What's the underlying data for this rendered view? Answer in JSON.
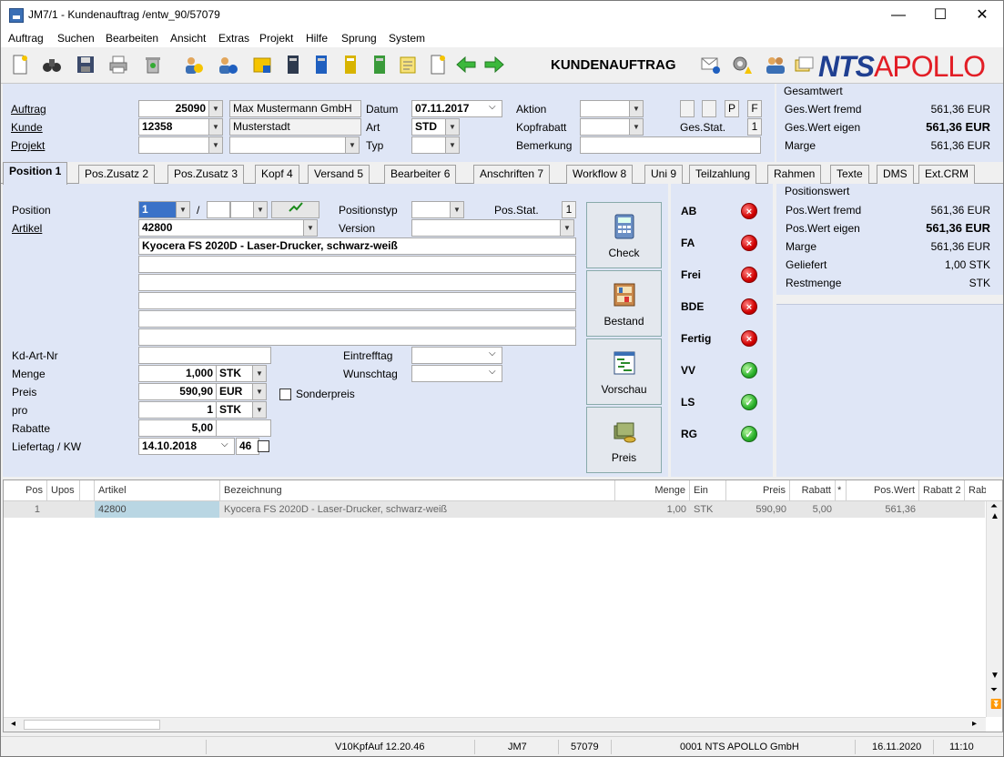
{
  "window": {
    "title": "JM7/1 - Kundenauftrag /entw_90/57079",
    "minimize": "—",
    "maximize": "☐",
    "close": "✕"
  },
  "menu": [
    "Auftrag",
    "Suchen",
    "Bearbeiten",
    "Ansicht",
    "Extras",
    "Projekt",
    "Hilfe",
    "Sprung",
    "System"
  ],
  "toolbar": {
    "page_title": "KUNDENAUFTRAG",
    "logo_nts": "NTS",
    "logo_apollo": "APOLLO"
  },
  "header": {
    "auftrag_label": "Auftrag",
    "auftrag_value": "25090",
    "auftrag_name": "Max Mustermann GmbH",
    "kunde_label": "Kunde",
    "kunde_value": "12358",
    "kunde_city": "Musterstadt",
    "projekt_label": "Projekt",
    "datum_label": "Datum",
    "datum_value": "07.11.2017",
    "art_label": "Art",
    "art_value": "STD",
    "typ_label": "Typ",
    "aktion_label": "Aktion",
    "kopfrabatt_label": "Kopfrabatt",
    "bemerkung_label": "Bemerkung",
    "p_label": "P",
    "f_label": "F",
    "gesstat_label": "Ges.Stat.",
    "gesstat_value": "1"
  },
  "gesamtwert": {
    "title": "Gesamtwert",
    "rows": [
      {
        "label": "Ges.Wert fremd",
        "value": "561,36 EUR",
        "bold": false
      },
      {
        "label": "Ges.Wert eigen",
        "value": "561,36 EUR",
        "bold": true
      },
      {
        "label": "Marge",
        "value": "561,36 EUR",
        "bold": false
      }
    ]
  },
  "tabs": [
    "Position 1",
    "Pos.Zusatz 2",
    "Pos.Zusatz 3",
    "Kopf 4",
    "Versand 5",
    "Bearbeiter 6",
    "Anschriften 7",
    "Workflow 8",
    "Uni 9",
    "Teilzahlung",
    "Rahmen",
    "Texte",
    "DMS",
    "Ext.CRM"
  ],
  "position": {
    "position_label": "Position",
    "position_value": "1",
    "slash": "/",
    "artikel_label": "Artikel",
    "artikel_value": "42800",
    "postyp_label": "Positionstyp",
    "posstat_label": "Pos.Stat.",
    "posstat_value": "1",
    "version_label": "Version",
    "description": "Kyocera FS 2020D - Laser-Drucker, schwarz-weiß",
    "kdartnr_label": "Kd-Art-Nr",
    "menge_label": "Menge",
    "menge_value": "1,000",
    "menge_unit": "STK",
    "preis_label": "Preis",
    "preis_value": "590,90",
    "preis_unit": "EUR",
    "pro_label": "pro",
    "pro_value": "1",
    "pro_unit": "STK",
    "rabatte_label": "Rabatte",
    "rabatte_value": "5,00",
    "liefertag_label": "Liefertag / KW",
    "liefertag_value": "14.10.2018",
    "kw_value": "46",
    "eintrefftag_label": "Eintrefftag",
    "wunschtag_label": "Wunschtag",
    "sonderpreis_label": "Sonderpreis"
  },
  "actions": {
    "check": "Check",
    "bestand": "Bestand",
    "vorschau": "Vorschau",
    "preis": "Preis"
  },
  "status": [
    {
      "label": "AB",
      "state": "red"
    },
    {
      "label": "FA",
      "state": "red"
    },
    {
      "label": "Frei",
      "state": "red"
    },
    {
      "label": "BDE",
      "state": "red"
    },
    {
      "label": "Fertig",
      "state": "red"
    },
    {
      "label": "VV",
      "state": "green"
    },
    {
      "label": "LS",
      "state": "green"
    },
    {
      "label": "RG",
      "state": "green"
    }
  ],
  "positionswert": {
    "title": "Positionswert",
    "rows": [
      {
        "label": "Pos.Wert fremd",
        "value": "561,36 EUR",
        "bold": false
      },
      {
        "label": "Pos.Wert eigen",
        "value": "561,36 EUR",
        "bold": true
      },
      {
        "label": "Marge",
        "value": "561,36 EUR",
        "bold": false
      },
      {
        "label": "Geliefert",
        "value": "1,00 STK",
        "bold": false
      },
      {
        "label": "Restmenge",
        "value": "STK",
        "bold": false
      }
    ]
  },
  "grid": {
    "columns": [
      "Pos",
      "Upos",
      "Artikel",
      "Bezeichnung",
      "Menge",
      "Ein",
      "Preis",
      "Rabatt",
      "*",
      "Pos.Wert",
      "Rabatt 2",
      "Rab"
    ],
    "rows": [
      [
        "1",
        "",
        "42800",
        "Kyocera FS 2020D - Laser-Drucker, schwarz-weiß",
        "1,00",
        "STK",
        "590,90",
        "5,00",
        "",
        "561,36",
        "",
        ""
      ]
    ]
  },
  "statusbar": [
    "V10KpfAuf 12.20.46",
    "JM7",
    "57079",
    "0001 NTS APOLLO GmbH",
    "16.11.2020",
    "11:10"
  ]
}
